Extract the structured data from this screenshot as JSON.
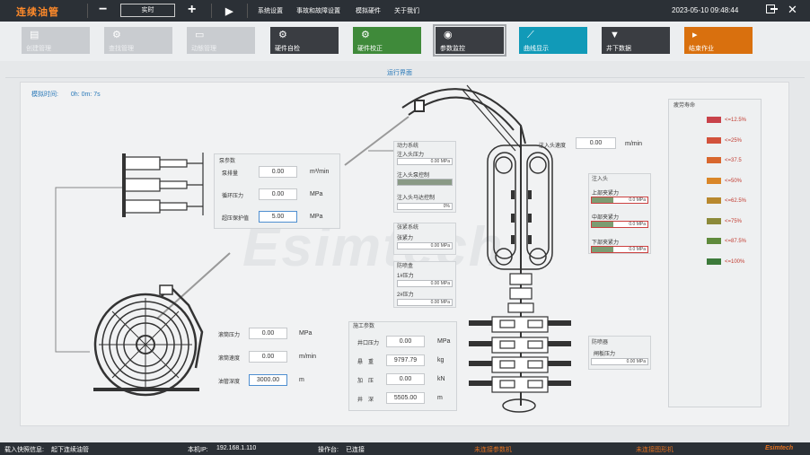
{
  "app": {
    "title": "连续油管",
    "mode": "实时",
    "menu": [
      "系统设置",
      "事故和故障设置",
      "模拟硬件",
      "关于我们"
    ],
    "datetime": "2023-05-10  09:48:44"
  },
  "toolbar": [
    {
      "label": "创建管理",
      "icon": "create-icon",
      "state": "disabled"
    },
    {
      "label": "查找管理",
      "icon": "search-manage-icon",
      "state": "disabled"
    },
    {
      "label": "动態管理",
      "icon": "doc-manage-icon",
      "state": "disabled"
    },
    {
      "label": "硬件自检",
      "icon": "gear-check-icon",
      "state": "dark"
    },
    {
      "label": "硬件校正",
      "icon": "gear-calibrate-icon",
      "state": "green"
    },
    {
      "label": "参数监控",
      "icon": "eye-icon",
      "state": "active"
    },
    {
      "label": "曲线显示",
      "icon": "chart-icon",
      "state": "teal"
    },
    {
      "label": "井下数据",
      "icon": "well-icon",
      "state": "dark"
    },
    {
      "label": "结束作业",
      "icon": "finish-icon",
      "state": "orange"
    }
  ],
  "main": {
    "section_title": "运行界面",
    "sim_time_label": "模拟时间:",
    "sim_time_value": "0h:  0m:  7s"
  },
  "pump": {
    "title": "泵参数",
    "rows": [
      {
        "label": "泵排量",
        "value": "0.00",
        "unit": "m³/min"
      },
      {
        "label": "循环压力",
        "value": "0.00",
        "unit": "MPa"
      },
      {
        "label": "超压保护值",
        "value": "5.00",
        "unit": "MPa"
      }
    ]
  },
  "reel": {
    "rows": [
      {
        "label": "滚筒压力",
        "value": "0.00",
        "unit": "MPa"
      },
      {
        "label": "滚筒速度",
        "value": "0.00",
        "unit": "m/min"
      },
      {
        "label": "油管深度",
        "value": "3000.00",
        "unit": "m"
      }
    ]
  },
  "power": {
    "title": "动力系统",
    "items": [
      {
        "label": "注入头压力",
        "value": "0.00 MPa",
        "fill": 0
      },
      {
        "label": "注入头泵控制",
        "value": "",
        "fill": 1.0
      },
      {
        "label": "注入头马达控制",
        "value": "0%",
        "fill": 0
      }
    ]
  },
  "tension": {
    "title": "张紧系统",
    "items": [
      {
        "label": "张紧力",
        "value": "0.00 MPa",
        "fill": 0
      }
    ]
  },
  "bop": {
    "title": "防喷盒",
    "items": [
      {
        "label": "1#压力",
        "value": "0.00 MPa",
        "fill": 0
      },
      {
        "label": "2#压力",
        "value": "0.00 MPa",
        "fill": 0
      }
    ]
  },
  "construction": {
    "title": "施工参数",
    "rows": [
      {
        "label": "井口压力",
        "value": "0.00",
        "unit": "MPa"
      },
      {
        "label": "悬　重",
        "value": "9797.79",
        "unit": "kg"
      },
      {
        "label": "加　压",
        "value": "0.00",
        "unit": "kN"
      },
      {
        "label": "井　深",
        "value": "5505.00",
        "unit": "m"
      }
    ]
  },
  "injector_speed": {
    "label": "注入头速度",
    "value": "0.00",
    "unit": "m/min"
  },
  "injector": {
    "title": "注入头",
    "items": [
      {
        "label": "上部夹紧力",
        "value": "0.0 MPa",
        "fill": 0.8
      },
      {
        "label": "中部夹紧力",
        "value": "0.0 MPa",
        "fill": 0.8
      },
      {
        "label": "下部夹紧力",
        "value": "0.0 MPa",
        "fill": 0.8
      }
    ]
  },
  "bop_stack": {
    "title": "防喷器",
    "items": [
      {
        "label": "闸板压力",
        "value": "0.00 MPa",
        "fill": 0
      }
    ]
  },
  "life": {
    "title": "疲劳寿命",
    "fill": 1.0,
    "legend": [
      {
        "label": "<=12.5%",
        "color": "#c8424a"
      },
      {
        "label": "<=25%",
        "color": "#d2523c"
      },
      {
        "label": "<=37.5",
        "color": "#d8672e"
      },
      {
        "label": "<=50%",
        "color": "#d98628"
      },
      {
        "label": "<=62.5%",
        "color": "#b8882e"
      },
      {
        "label": "<=75%",
        "color": "#8c8a3a"
      },
      {
        "label": "<=87.5%",
        "color": "#5f8a3c"
      },
      {
        "label": "<=100%",
        "color": "#3c7a3a"
      }
    ]
  },
  "watermark": "Esimtech",
  "status": {
    "info_label": "载入快照信息:",
    "info_value": "起下连续油管",
    "ip_label": "本机IP:",
    "ip_value": "192.168.1.110",
    "console_label": "操作台:",
    "console_value": "已连接",
    "warn1": "未连接参数机",
    "warn2": "未连接图形机",
    "brand": "Esimtech"
  },
  "colors": {
    "accent": "#ff8a2a",
    "link": "#2878b8",
    "warn": "#e07020"
  }
}
